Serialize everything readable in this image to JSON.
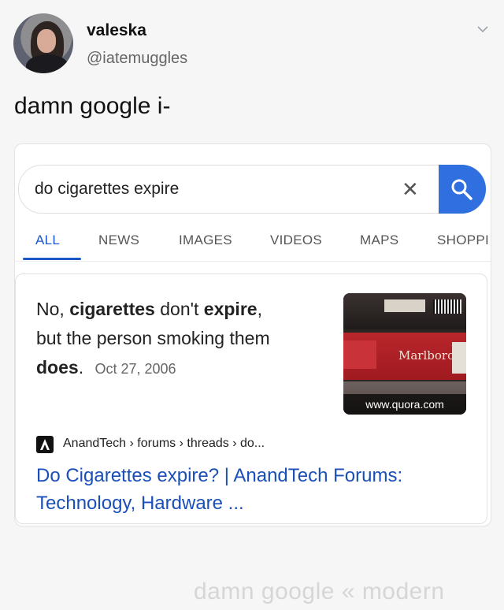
{
  "tweet": {
    "name": "valeska",
    "handle": "@iatemuggles",
    "text": "damn google i-"
  },
  "search": {
    "query": "do cigarettes expire",
    "clear_label": "✕"
  },
  "tabs": [
    {
      "label": "ALL",
      "active": true
    },
    {
      "label": "NEWS"
    },
    {
      "label": "IMAGES"
    },
    {
      "label": "VIDEOS"
    },
    {
      "label": "MAPS"
    },
    {
      "label": "SHOPPI"
    }
  ],
  "answer": {
    "p1": "No, ",
    "b1": "cigarettes",
    "p2": " don't ",
    "b2": "expire",
    "p3": ",",
    "p4": "but the person smoking them",
    "b3": "does",
    "p5": ".",
    "date": "Oct 27, 2006",
    "thumb_text": "Marlboro",
    "thumb_source": "www.quora.com"
  },
  "result": {
    "site": "AnandTech",
    "breadcrumb": "AnandTech › forums › threads › do...",
    "title": "Do Cigarettes expire? | AnandTech Forums: Technology, Hardware ..."
  },
  "watermark": "damn google « modern"
}
